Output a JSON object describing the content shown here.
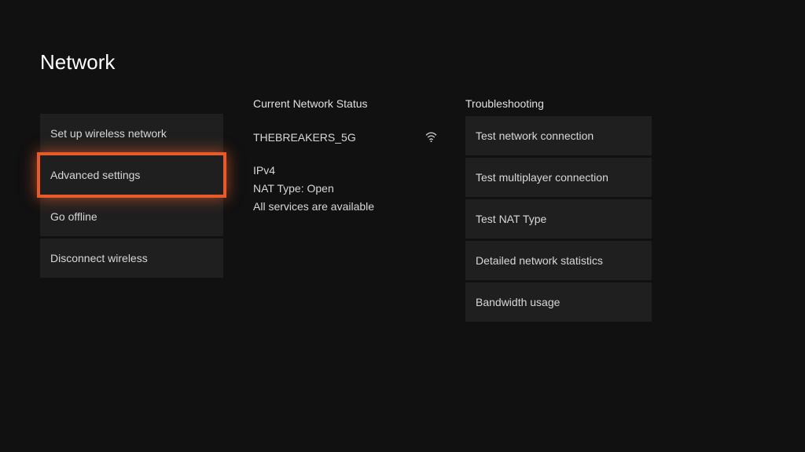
{
  "page": {
    "title": "Network"
  },
  "left_menu": {
    "items": [
      {
        "label": "Set up wireless network"
      },
      {
        "label": "Advanced settings"
      },
      {
        "label": "Go offline"
      },
      {
        "label": "Disconnect wireless"
      }
    ],
    "selected_index": 1
  },
  "status": {
    "heading": "Current Network Status",
    "ssid": "THEBREAKERS_5G",
    "ip_version": "IPv4",
    "nat_line": "NAT Type: Open",
    "services_line": "All services are available",
    "icon": "wifi-icon"
  },
  "troubleshooting": {
    "heading": "Troubleshooting",
    "items": [
      {
        "label": "Test network connection"
      },
      {
        "label": "Test multiplayer connection"
      },
      {
        "label": "Test NAT Type"
      },
      {
        "label": "Detailed network statistics"
      },
      {
        "label": "Bandwidth usage"
      }
    ]
  }
}
